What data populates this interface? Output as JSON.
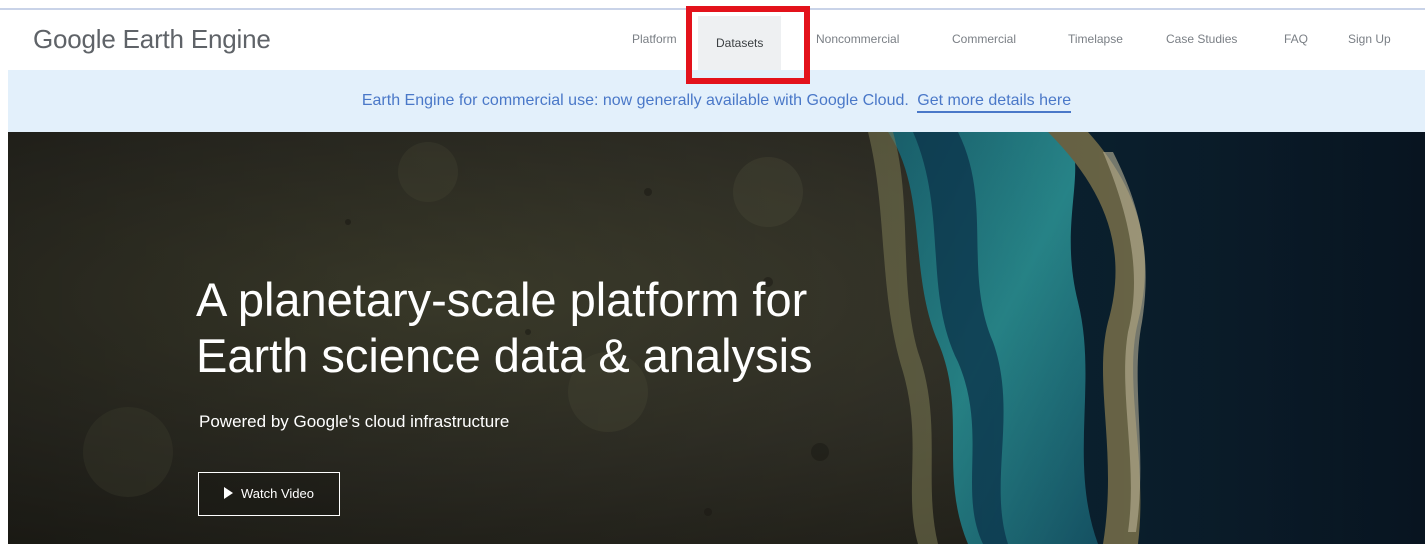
{
  "header": {
    "logo_text": "Google Earth Engine",
    "nav": [
      {
        "label": "Platform",
        "active": false
      },
      {
        "label": "Datasets",
        "active": true
      },
      {
        "label": "Noncommercial",
        "active": false
      },
      {
        "label": "Commercial",
        "active": false
      },
      {
        "label": "Timelapse",
        "active": false
      },
      {
        "label": "Case Studies",
        "active": false
      },
      {
        "label": "FAQ",
        "active": false
      },
      {
        "label": "Sign Up",
        "active": false
      }
    ]
  },
  "banner": {
    "text": "Earth Engine for commercial use: now generally available with Google Cloud.",
    "link_text": "Get more details here"
  },
  "hero": {
    "title_line1": "A planetary-scale platform for",
    "title_line2": "Earth science data & analysis",
    "subtitle": "Powered by Google's cloud infrastructure",
    "watch_video_label": "Watch Video"
  },
  "colors": {
    "highlight": "#e3121b",
    "banner_bg": "#e3f0fb",
    "banner_text": "#4a78c8",
    "nav_text": "#7a7f85"
  }
}
